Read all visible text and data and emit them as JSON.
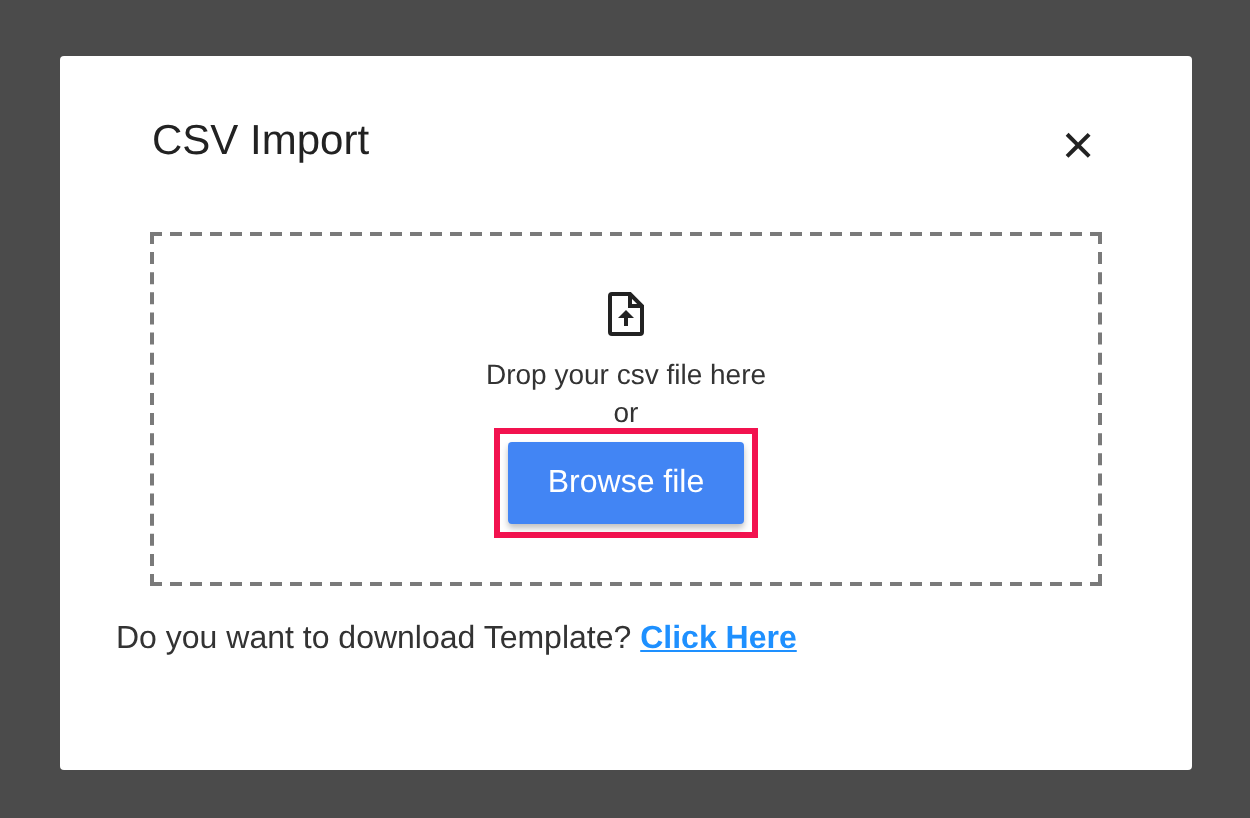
{
  "dialog": {
    "title": "CSV Import",
    "close_label": "×"
  },
  "dropzone": {
    "prompt": "Drop your csv file here",
    "separator": "or",
    "button": {
      "label": "Browse file",
      "highlighted": true
    }
  },
  "footer": {
    "question": "Do you want to download Template?",
    "link": "Click Here"
  }
}
